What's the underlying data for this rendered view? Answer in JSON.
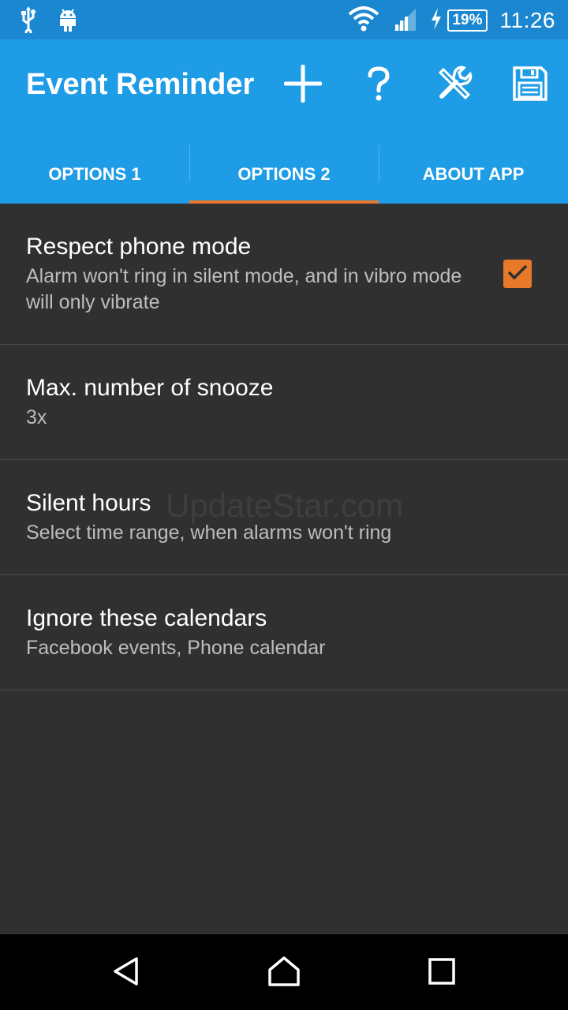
{
  "status_bar": {
    "icons_left": [
      "usb-icon",
      "android-icon"
    ],
    "icons_right": [
      "wifi-icon",
      "signal-icon",
      "charging-icon"
    ],
    "battery": "19%",
    "time": "11:26"
  },
  "app_bar": {
    "title": "Event Reminder",
    "actions": [
      "add-icon",
      "help-icon",
      "tools-icon",
      "save-icon"
    ],
    "color": "#1e9ce6"
  },
  "tabs": [
    {
      "label": "OPTIONS 1",
      "active": false
    },
    {
      "label": "OPTIONS 2",
      "active": true
    },
    {
      "label": "ABOUT APP",
      "active": false
    }
  ],
  "accent_color": "#e8782a",
  "preferences": [
    {
      "title": "Respect phone mode",
      "summary": "Alarm won't ring in silent mode, and in vibro mode will only vibrate",
      "checked": true
    },
    {
      "title": "Max. number of snooze",
      "summary": "3x"
    },
    {
      "title": "Silent hours",
      "summary": "Select time range, when alarms won't ring"
    },
    {
      "title": "Ignore these calendars",
      "summary": "Facebook events, Phone calendar"
    }
  ],
  "watermark": "UpdateStar.com",
  "nav_bar": [
    "back-icon",
    "home-icon",
    "recents-icon"
  ]
}
